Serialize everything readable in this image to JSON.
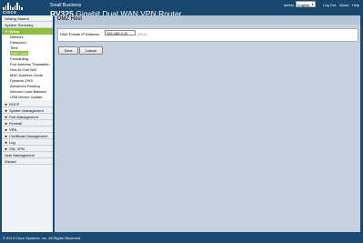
{
  "brand": {
    "logo": "cisco",
    "subtitle": "Small Business",
    "model_number": "RV325",
    "model_name": "Gigabit Dual WAN VPN Router"
  },
  "toolbar": {
    "user": "admin",
    "language": "English",
    "logout": "Log Out",
    "about": "About",
    "help": "Help"
  },
  "sidebar": {
    "getting_started": "Getting Started",
    "system_summary": "System Summary",
    "setup": "▼ Setup",
    "setup_items": [
      "Network",
      "Password",
      "Time",
      "DMZ Host",
      "Forwarding",
      "Port Address Translation",
      "One-to-One NAT",
      "MAC Address Clone",
      "Dynamic DNS",
      "Advanced Routing",
      "Inbound Load Balance",
      "USB Device Update"
    ],
    "categories": [
      "► DHCP",
      "► System Management",
      "► Port Management",
      "► Firewall",
      "► VPN",
      "► Certificate Management",
      "► Log",
      "► SSL VPN",
      "User Management",
      "Wizard"
    ]
  },
  "main": {
    "title": "DMZ Host",
    "field_label": "DMZ Private IP Address:",
    "field_value": "192.168.0.10",
    "field_hint": "(IPv4)",
    "save_label": "Save",
    "cancel_label": "Cancel"
  },
  "footer": {
    "copyright": "© 2013 Cisco Systems, Inc. All Rights Reserved."
  },
  "colors": {
    "header": "#17466e",
    "active": "#8dc03f",
    "content_bg": "#c5d1de"
  }
}
